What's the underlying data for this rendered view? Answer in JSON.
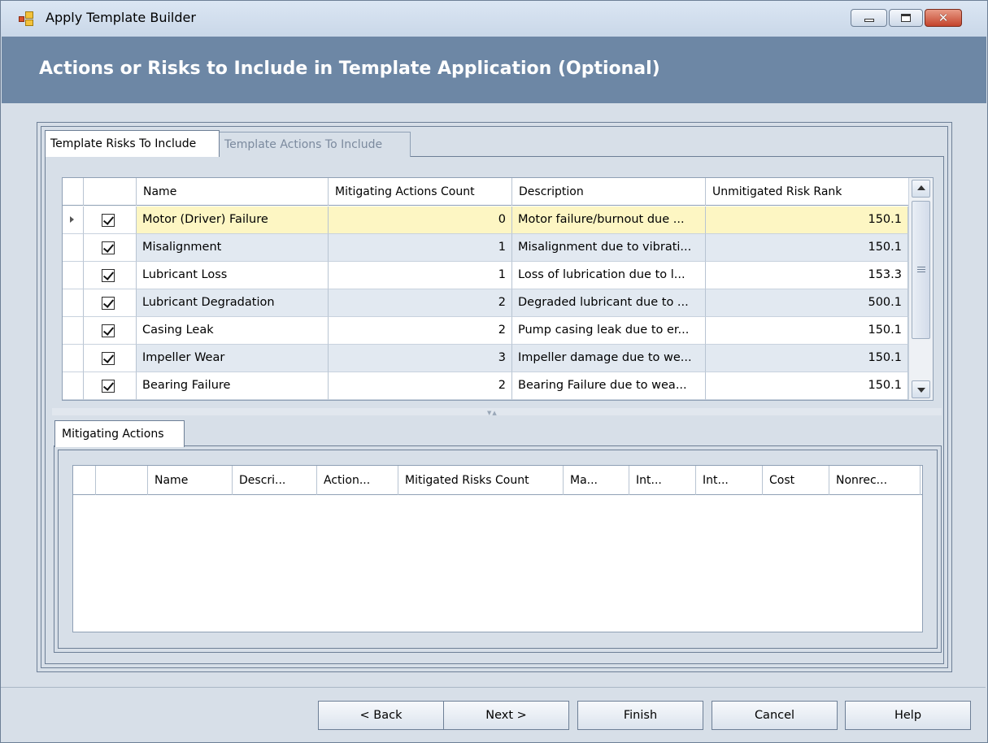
{
  "window": {
    "title": "Apply Template Builder",
    "header": "Actions or Risks to Include in Template Application (Optional)"
  },
  "tabs": {
    "risks": "Template Risks To Include",
    "actions": "Template Actions To Include"
  },
  "risks_grid": {
    "columns": [
      "Name",
      "Mitigating Actions Count",
      "Description",
      "Unmitigated Risk Rank"
    ],
    "rows": [
      {
        "checked": true,
        "name": "Motor (Driver) Failure",
        "count": "0",
        "description": "Motor failure/burnout due ...",
        "rank": "150.1",
        "selected": true
      },
      {
        "checked": true,
        "name": "Misalignment",
        "count": "1",
        "description": "Misalignment due to vibrati...",
        "rank": "150.1"
      },
      {
        "checked": true,
        "name": "Lubricant Loss",
        "count": "1",
        "description": "Loss of lubrication due to l...",
        "rank": "153.3"
      },
      {
        "checked": true,
        "name": "Lubricant Degradation",
        "count": "2",
        "description": "Degraded lubricant due to ...",
        "rank": "500.1"
      },
      {
        "checked": true,
        "name": "Casing Leak",
        "count": "2",
        "description": "Pump casing leak due to er...",
        "rank": "150.1"
      },
      {
        "checked": true,
        "name": "Impeller Wear",
        "count": "3",
        "description": "Impeller damage due to we...",
        "rank": "150.1"
      },
      {
        "checked": true,
        "name": "Bearing Failure",
        "count": "2",
        "description": "Bearing Failure due to wea...",
        "rank": "150.1"
      }
    ]
  },
  "mitigating": {
    "tab": "Mitigating Actions",
    "columns": [
      "Name",
      "Descri...",
      "Action...",
      "Mitigated Risks Count",
      "Ma...",
      "Int...",
      "Int...",
      "Cost",
      "Nonrec..."
    ]
  },
  "buttons": {
    "back": "< Back",
    "next": "Next >",
    "finish": "Finish",
    "cancel": "Cancel",
    "help": "Help"
  },
  "colors": {
    "header_band": "#6d87a5",
    "selected_row": "#fdf6c3",
    "alt_row": "#e2e9f1"
  }
}
